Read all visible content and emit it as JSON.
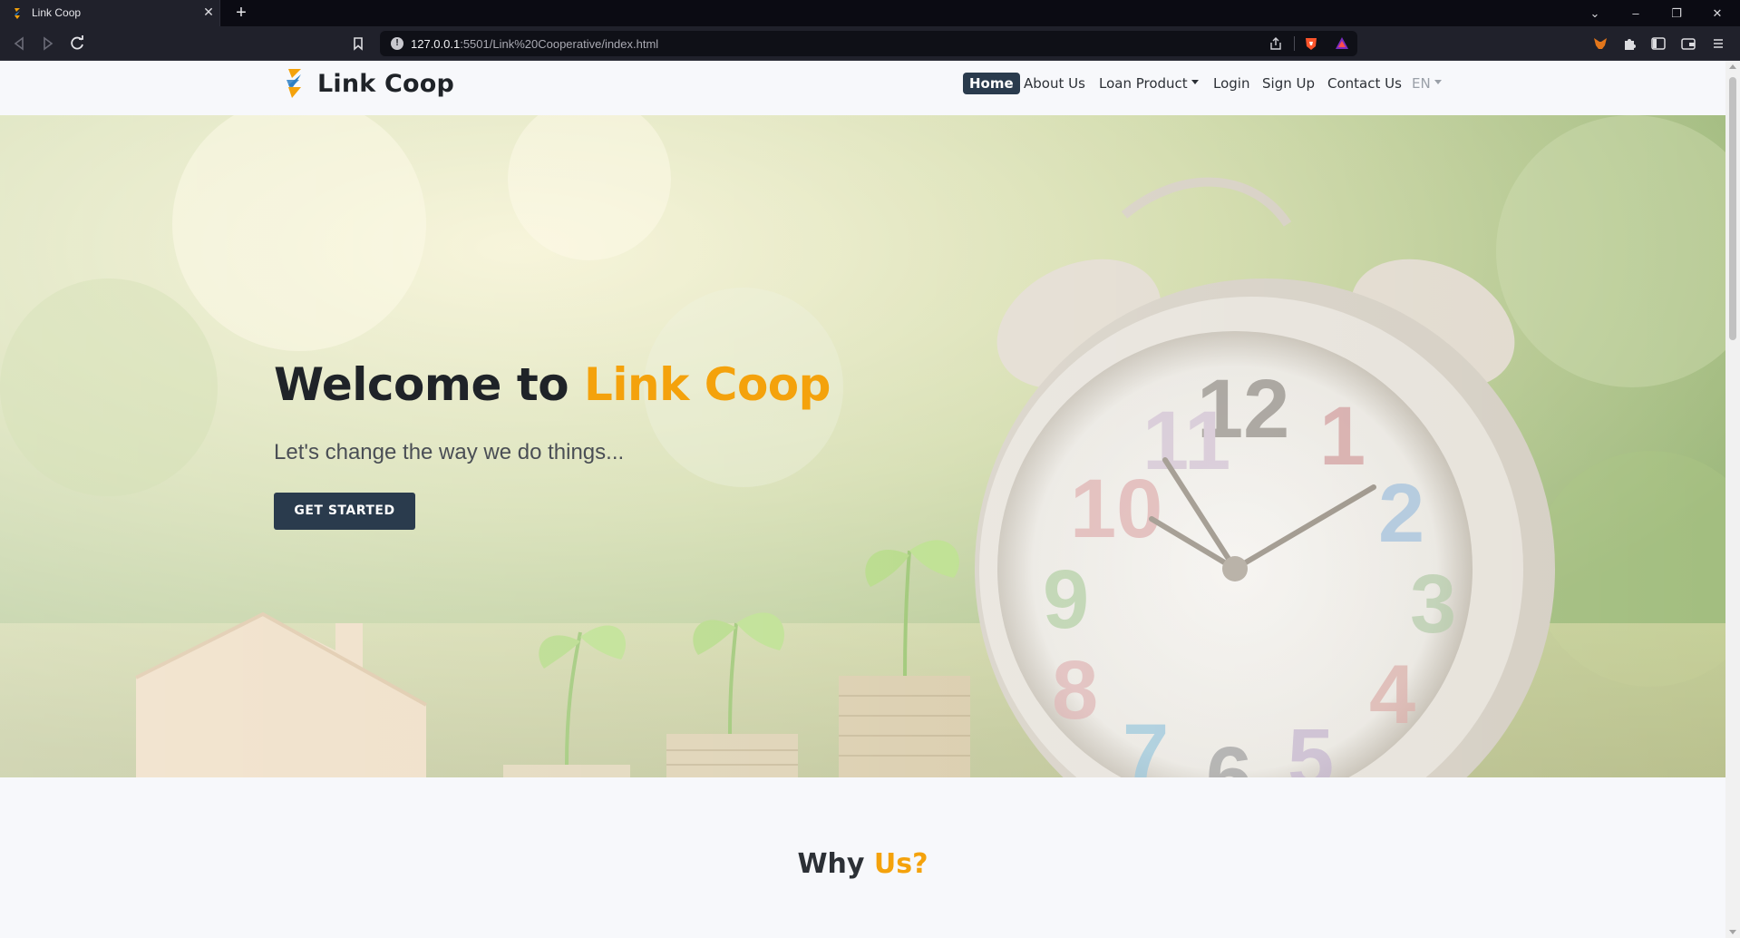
{
  "browser": {
    "tab_title": "Link Coop",
    "tab_close": "✕",
    "new_tab": "+",
    "url_host": "127.0.0.1",
    "url_rest": ":5501/Link%20Cooperative/index.html",
    "window_controls": [
      "⌄",
      "–",
      "❐",
      "✕"
    ]
  },
  "site": {
    "brand": "Link Coop",
    "colors": {
      "accent": "#f4a20c",
      "primary": "#2a3b4d",
      "text": "#1f2328"
    }
  },
  "nav": {
    "home": "Home",
    "about": "About Us",
    "loan_product": "Loan Product",
    "login": "Login",
    "signup": "Sign Up",
    "contact": "Contact Us",
    "language": "EN"
  },
  "hero": {
    "title_prefix": "Welcome to ",
    "title_accent": "Link Coop",
    "subtitle": "Let's change the way we do things...",
    "cta": "GET STARTED"
  },
  "why": {
    "title_prefix": "Why ",
    "title_accent": "Us?"
  }
}
